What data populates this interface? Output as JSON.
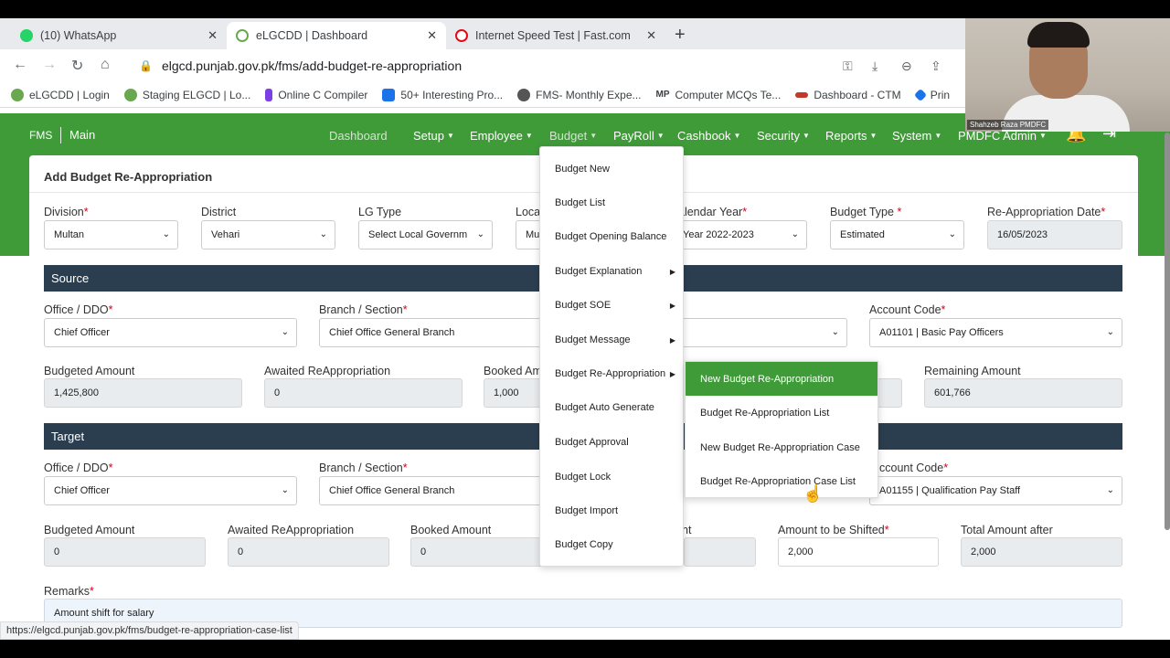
{
  "browser": {
    "tabs": [
      {
        "label": "(10) WhatsApp",
        "icon": "whatsapp-icon",
        "color": "#25d366"
      },
      {
        "label": "eLGCDD | Dashboard",
        "icon": "punjab-logo-icon",
        "color": "#6aa84f"
      },
      {
        "label": "Internet Speed Test | Fast.com",
        "icon": "speedometer-icon",
        "color": "#e50914"
      }
    ],
    "new_tab": "+",
    "url": "elgcd.punjab.gov.pk/fms/add-budget-re-appropriation",
    "bookmarks": [
      {
        "label": "eLGCDD | Login",
        "color": "#6aa84f"
      },
      {
        "label": "Staging ELGCD | Lo...",
        "color": "#6aa84f"
      },
      {
        "label": "Online C Compiler",
        "color": "#7b3fe4"
      },
      {
        "label": "50+ Interesting Pro...",
        "color": "#1a73e8"
      },
      {
        "label": "FMS- Monthly Expe...",
        "color": "#555555"
      },
      {
        "label": "Computer MCQs Te...",
        "color": "#222222"
      },
      {
        "label": "Dashboard - CTM",
        "color": "#c0392b"
      },
      {
        "label": "Prin",
        "color": "#1a73e8"
      }
    ],
    "mp_prefix": "MP",
    "status_url": "https://elgcd.punjab.gov.pk/fms/budget-re-appropriation-case-list"
  },
  "webcam": {
    "caption": "Shahzeb Raza PMDFC"
  },
  "app": {
    "brand": "FMS",
    "brand_main": "Main",
    "menu": {
      "dashboard": "Dashboard",
      "setup": "Setup",
      "employee": "Employee",
      "budget": "Budget",
      "payroll": "PayRoll",
      "cashbook": "Cashbook",
      "security": "Security",
      "reports": "Reports",
      "system": "System",
      "user": "PMDFC Admin"
    },
    "accent": "#3f9b38",
    "section_color": "#2b3e50"
  },
  "form": {
    "title": "Add Budget Re-Appropriation",
    "division": {
      "label": "Division",
      "value": "Multan"
    },
    "district": {
      "label": "District",
      "value": "Vehari"
    },
    "lg_type": {
      "label": "LG Type",
      "value": "Select Local Governm"
    },
    "local": {
      "label": "Loca",
      "value": "Mu"
    },
    "calendar_year": {
      "label": "alendar Year",
      "value": "Year 2022-2023"
    },
    "budget_type": {
      "label": "Budget Type",
      "value": "Estimated"
    },
    "reapp_date": {
      "label": "Re-Appropriation Date",
      "value": "16/05/2023"
    },
    "source": {
      "title": "Source",
      "office_label": "Office / DDO",
      "office_value": "Chief Officer",
      "branch_label": "Branch / Section",
      "branch_value": "Chief Office General Branch",
      "account_label": "Account Code",
      "account_value": "A01101 | Basic Pay Officers",
      "budgeted_label": "Budgeted Amount",
      "budgeted_value": "1,425,800",
      "awaited_label": "Awaited ReAppropriation",
      "awaited_value": "0",
      "booked_label": "Booked Am",
      "booked_value": "1,000",
      "remaining_label": "Remaining Amount",
      "remaining_value": "601,766"
    },
    "target": {
      "title": "Target",
      "office_label": "Office / DDO",
      "office_value": "Chief Officer",
      "branch_label": "Branch / Section",
      "branch_value": "Chief Office General Branch",
      "account_label": "ccount Code",
      "account_value": "A01155 | Qualification Pay Staff",
      "budgeted_label": "Budgeted Amount",
      "budgeted_value": "0",
      "awaited_label": "Awaited ReAppropriation",
      "awaited_value": "0",
      "booked_label": "Booked Amount",
      "booked_value": "0",
      "partial_label": "nt",
      "shift_label": "Amount to be Shifted",
      "shift_value": "2,000",
      "total_label": "Total Amount after",
      "total_value": "2,000"
    },
    "remarks": {
      "label": "Remarks",
      "value": "Amount shift for salary"
    }
  },
  "budget_menu": {
    "items": [
      {
        "label": "Budget New",
        "has_sub": false
      },
      {
        "label": "Budget List",
        "has_sub": false
      },
      {
        "label": "Budget Opening Balance",
        "has_sub": false
      },
      {
        "label": "Budget Explanation",
        "has_sub": true
      },
      {
        "label": "Budget SOE",
        "has_sub": true
      },
      {
        "label": "Budget Message",
        "has_sub": true
      },
      {
        "label": "Budget Re-Appropriation",
        "has_sub": true
      },
      {
        "label": "Budget Auto Generate",
        "has_sub": false
      },
      {
        "label": "Budget Approval",
        "has_sub": false
      },
      {
        "label": "Budget Lock",
        "has_sub": false
      },
      {
        "label": "Budget Import",
        "has_sub": false
      },
      {
        "label": "Budget Copy",
        "has_sub": false
      }
    ],
    "submenu": [
      {
        "label": "New Budget Re-Appropriation",
        "active": true
      },
      {
        "label": "Budget Re-Appropriation List",
        "active": false
      },
      {
        "label": "New Budget Re-Appropriation Case",
        "active": false
      },
      {
        "label": "Budget Re-Appropriation Case List",
        "active": false
      }
    ]
  }
}
